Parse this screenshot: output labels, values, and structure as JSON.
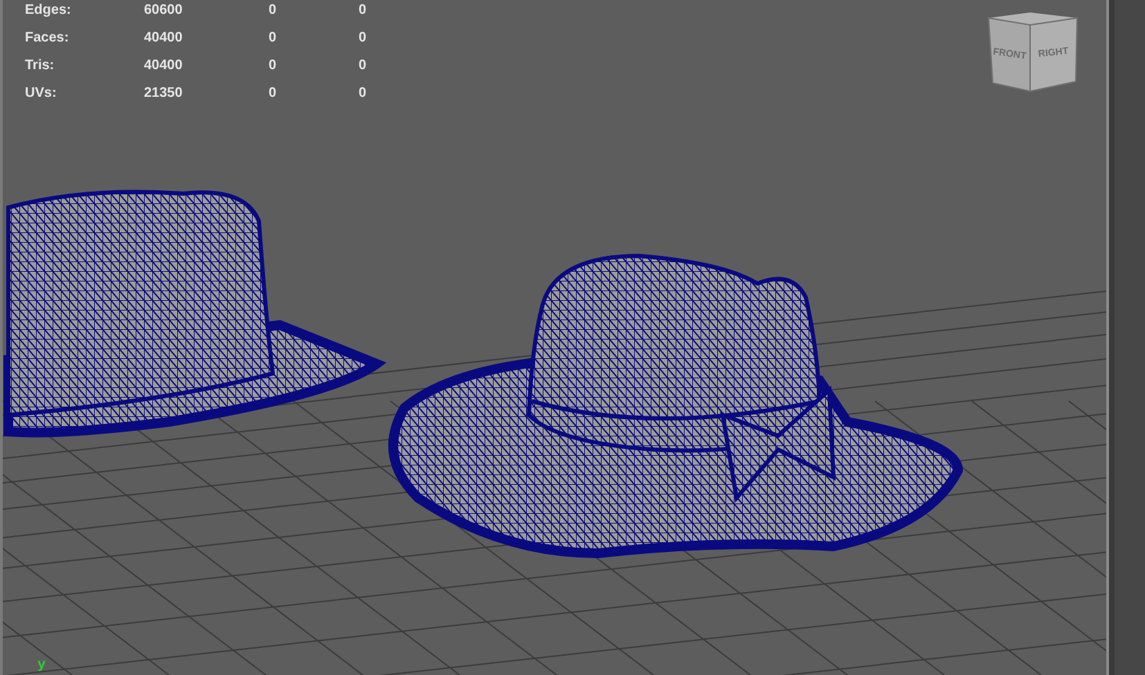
{
  "stats": [
    {
      "label": "Edges:",
      "values": [
        "60600",
        "0",
        "0"
      ]
    },
    {
      "label": "Faces:",
      "values": [
        "40400",
        "0",
        "0"
      ]
    },
    {
      "label": "Tris:",
      "values": [
        "40400",
        "0",
        "0"
      ]
    },
    {
      "label": "UVs:",
      "values": [
        "21350",
        "0",
        "0"
      ]
    }
  ],
  "view_cube": {
    "faces": [
      "FRONT",
      "RIGHT"
    ]
  },
  "axis_label": "y"
}
